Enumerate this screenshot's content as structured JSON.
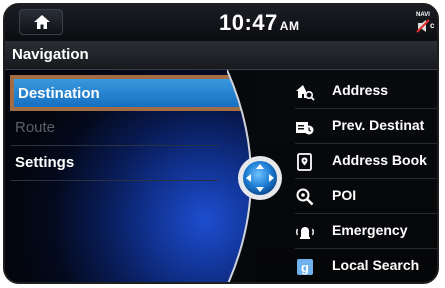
{
  "status_bar": {
    "time": "10:47",
    "ampm": "AM",
    "indicator_text": "NAVI",
    "indicator_small": "c"
  },
  "title": "Navigation",
  "left_menu": [
    {
      "label": "Destination",
      "state": "selected"
    },
    {
      "label": "Route",
      "state": "disabled"
    },
    {
      "label": "Settings",
      "state": "normal"
    }
  ],
  "right_menu": [
    {
      "label": "Address",
      "icon": "house-search-icon"
    },
    {
      "label": "Prev. Destinat",
      "icon": "previous-destination-icon"
    },
    {
      "label": "Address Book",
      "icon": "address-book-icon"
    },
    {
      "label": "POI",
      "icon": "poi-search-icon"
    },
    {
      "label": "Emergency",
      "icon": "emergency-icon"
    },
    {
      "label": "Local Search",
      "icon": "local-search-icon"
    }
  ],
  "colors": {
    "selected_fill": "#2a87d6",
    "selected_border": "#a26c45",
    "background": "#050608"
  }
}
